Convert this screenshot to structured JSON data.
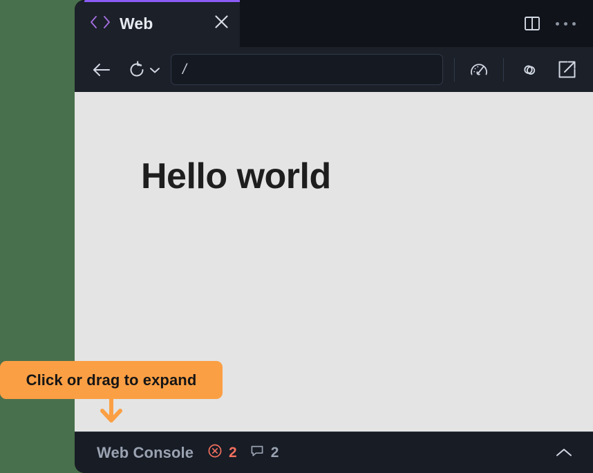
{
  "window": {
    "tab": {
      "label": "Web",
      "icon": "code-brackets-icon",
      "close_icon": "close-icon",
      "accent_color": "#8B5CF6"
    },
    "tabstrip_actions": [
      {
        "name": "split-pane-icon",
        "label": "Split pane"
      },
      {
        "name": "more-options-icon",
        "label": "More options"
      }
    ]
  },
  "toolbar": {
    "back_label": "Back",
    "reload_label": "Reload",
    "reload_menu_label": "Reload options",
    "url_value": "/",
    "url_placeholder": "/",
    "performance_label": "Performance",
    "link_label": "Copy link",
    "open_external_label": "Open in browser"
  },
  "page": {
    "heading": "Hello world",
    "background_color": "#E4E4E4"
  },
  "console": {
    "title": "Web Console",
    "error_count": "2",
    "message_count": "2",
    "error_color": "#F4705F",
    "expand_label": "Expand console"
  },
  "callout": {
    "text": "Click or drag to expand",
    "background_color": "#FB9F44",
    "arrow": "arrow-down-icon"
  },
  "desktop": {
    "background_color": "#49704C"
  }
}
